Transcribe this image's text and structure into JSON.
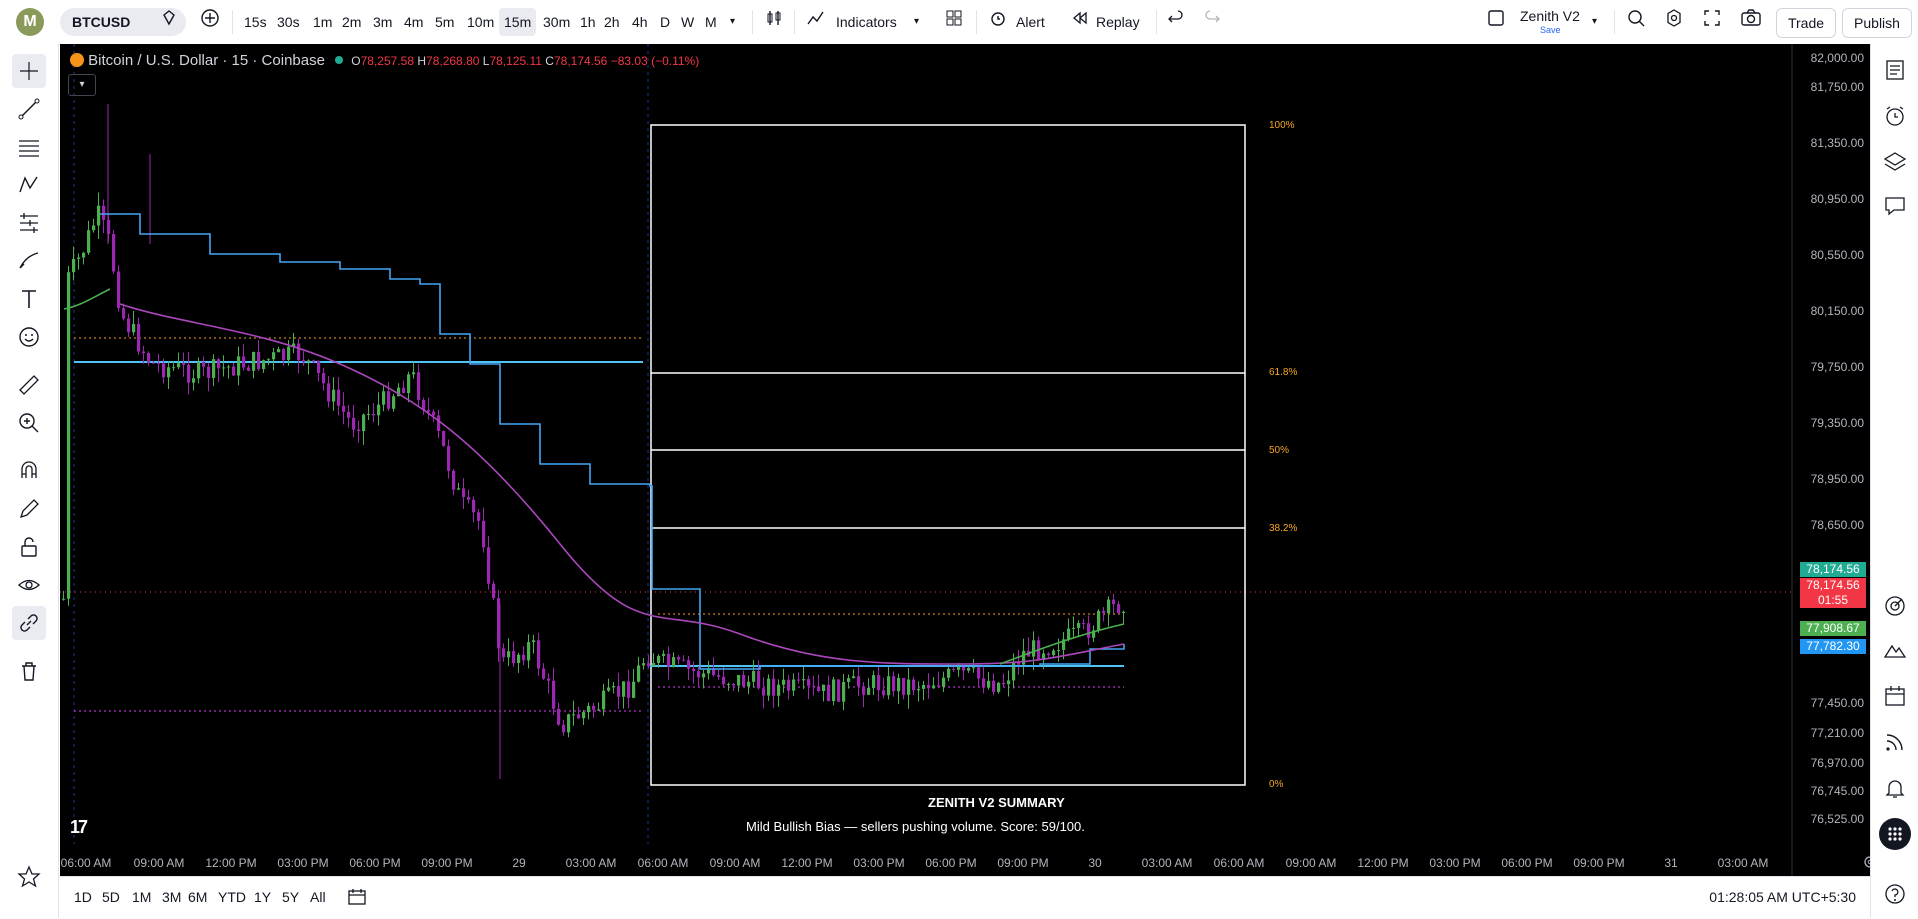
{
  "header": {
    "logo_letter": "M",
    "symbol": "BTCUSD",
    "intervals": [
      "15s",
      "30s",
      "1m",
      "2m",
      "3m",
      "4m",
      "5m",
      "10m",
      "15m",
      "30m",
      "1h",
      "2h",
      "4h",
      "D",
      "W",
      "M"
    ],
    "active_interval": "15m",
    "indicators_label": "Indicators",
    "alert_label": "Alert",
    "replay_label": "Replay",
    "layout_name": "Zenith V2",
    "layout_status": "Save",
    "trade_label": "Trade",
    "publish_label": "Publish"
  },
  "legend": {
    "title": "Bitcoin / U.S. Dollar · 15 · Coinbase",
    "o_label": "O",
    "o_value": "78,257.58",
    "h_label": "H",
    "h_value": "78,268.80",
    "l_label": "L",
    "l_value": "78,125.11",
    "c_label": "C",
    "c_value": "78,174.56",
    "change": "−83.03 (−0.11%)"
  },
  "price_axis": [
    "82,000.00",
    "81,750.00",
    "81,350.00",
    "80,950.00",
    "80,550.00",
    "80,150.00",
    "79,750.00",
    "79,350.00",
    "78,950.00",
    "78,650.00",
    "77,450.00",
    "77,210.00",
    "76,970.00",
    "76,745.00",
    "76,525.00"
  ],
  "price_tags": {
    "last_green": "78,174.56",
    "last_red": "78,174.56",
    "countdown": "01:55",
    "ma_green": "77,908.67",
    "ma_blue": "77,782.30"
  },
  "time_axis": [
    "06:00 AM",
    "09:00 AM",
    "12:00 PM",
    "03:00 PM",
    "06:00 PM",
    "09:00 PM",
    "29",
    "03:00 AM",
    "06:00 AM",
    "09:00 AM",
    "12:00 PM",
    "03:00 PM",
    "06:00 PM",
    "09:00 PM",
    "30",
    "03:00 AM",
    "06:00 AM",
    "09:00 AM",
    "12:00 PM",
    "03:00 PM",
    "06:00 PM",
    "09:00 PM",
    "31",
    "03:00 AM"
  ],
  "fib_levels": [
    "100%",
    "61.8%",
    "50%",
    "38.2%",
    "0%"
  ],
  "summary": {
    "title": "ZENITH V2 SUMMARY",
    "text": "Mild Bullish Bias — sellers pushing volume. Score: 59/100."
  },
  "bottom": {
    "ranges": [
      "1D",
      "5D",
      "1M",
      "3M",
      "6M",
      "YTD",
      "1Y",
      "5Y",
      "All"
    ],
    "clock": "01:28:05 AM UTC+5:30"
  },
  "colors": {
    "bull": "#4caf50",
    "bear": "#9c27b0",
    "vwap": "#42a5f5",
    "ma": "#ab47bc",
    "fib": "#f5a623"
  }
}
